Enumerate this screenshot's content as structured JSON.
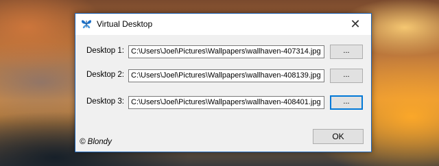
{
  "window": {
    "title": "Virtual Desktop",
    "close_symbol": "✕"
  },
  "rows": [
    {
      "label": "Desktop 1:",
      "path": "C:\\Users\\Joel\\Pictures\\Wallpapers\\wallhaven-407314.jpg",
      "button": "..."
    },
    {
      "label": "Desktop 2:",
      "path": "C:\\Users\\Joel\\Pictures\\Wallpapers\\wallhaven-408139.jpg",
      "button": "..."
    },
    {
      "label": "Desktop 3:",
      "path": "C:\\Users\\Joel\\Pictures\\Wallpapers\\wallhaven-408401.jpg",
      "button": "..."
    }
  ],
  "footer": {
    "copyright": "© Blondy",
    "ok_label": "OK"
  },
  "colors": {
    "accent": "#0078d7",
    "window_border": "#1c63b6"
  },
  "icons": {
    "app": "butterfly-icon",
    "close": "close-icon"
  }
}
